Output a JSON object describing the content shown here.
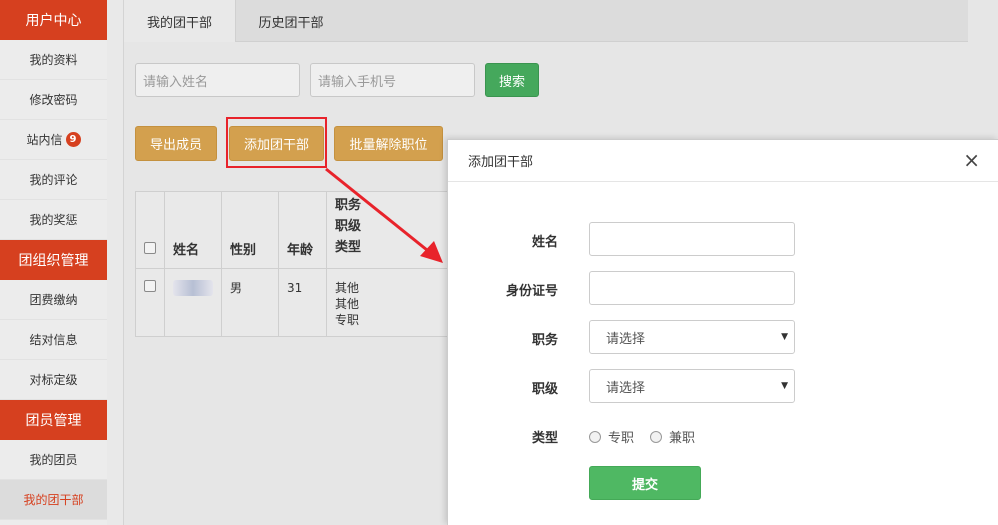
{
  "sidebar": {
    "sections": [
      {
        "title": "用户中心",
        "items": [
          {
            "label": "我的资料"
          },
          {
            "label": "修改密码"
          },
          {
            "label": "站内信",
            "badge": "9"
          },
          {
            "label": "我的评论"
          },
          {
            "label": "我的奖惩"
          }
        ]
      },
      {
        "title": "团组织管理",
        "items": [
          {
            "label": "团费缴纳"
          },
          {
            "label": "结对信息"
          },
          {
            "label": "对标定级"
          }
        ]
      },
      {
        "title": "团员管理",
        "items": [
          {
            "label": "我的团员"
          },
          {
            "label": "我的团干部",
            "active": true
          }
        ]
      }
    ]
  },
  "tabs": [
    {
      "label": "我的团干部",
      "active": true
    },
    {
      "label": "历史团干部"
    }
  ],
  "search": {
    "name_placeholder": "请输入姓名",
    "phone_placeholder": "请输入手机号",
    "search_label": "搜索"
  },
  "toolbar": {
    "export_label": "导出成员",
    "add_label": "添加团干部",
    "batch_label": "批量解除职位"
  },
  "table": {
    "headers": {
      "name": "姓名",
      "gender": "性别",
      "age": "年龄",
      "pos1": "职务",
      "pos2": "职级",
      "pos3": "类型"
    },
    "rows": [
      {
        "gender": "男",
        "age": "31",
        "duty": "其他",
        "level": "其他",
        "type": "专职"
      }
    ]
  },
  "modal": {
    "title": "添加团干部",
    "close": "×",
    "fields": {
      "name_label": "姓名",
      "id_label": "身份证号",
      "duty_label": "职务",
      "duty_value": "请选择",
      "level_label": "职级",
      "level_value": "请选择",
      "type_label": "类型",
      "type_opt1": "专职",
      "type_opt2": "兼职"
    },
    "submit_label": "提交"
  },
  "colors": {
    "brand": "#d6401f",
    "green": "#45a85c",
    "orange": "#d3a04e",
    "annotation": "#e8232b"
  }
}
